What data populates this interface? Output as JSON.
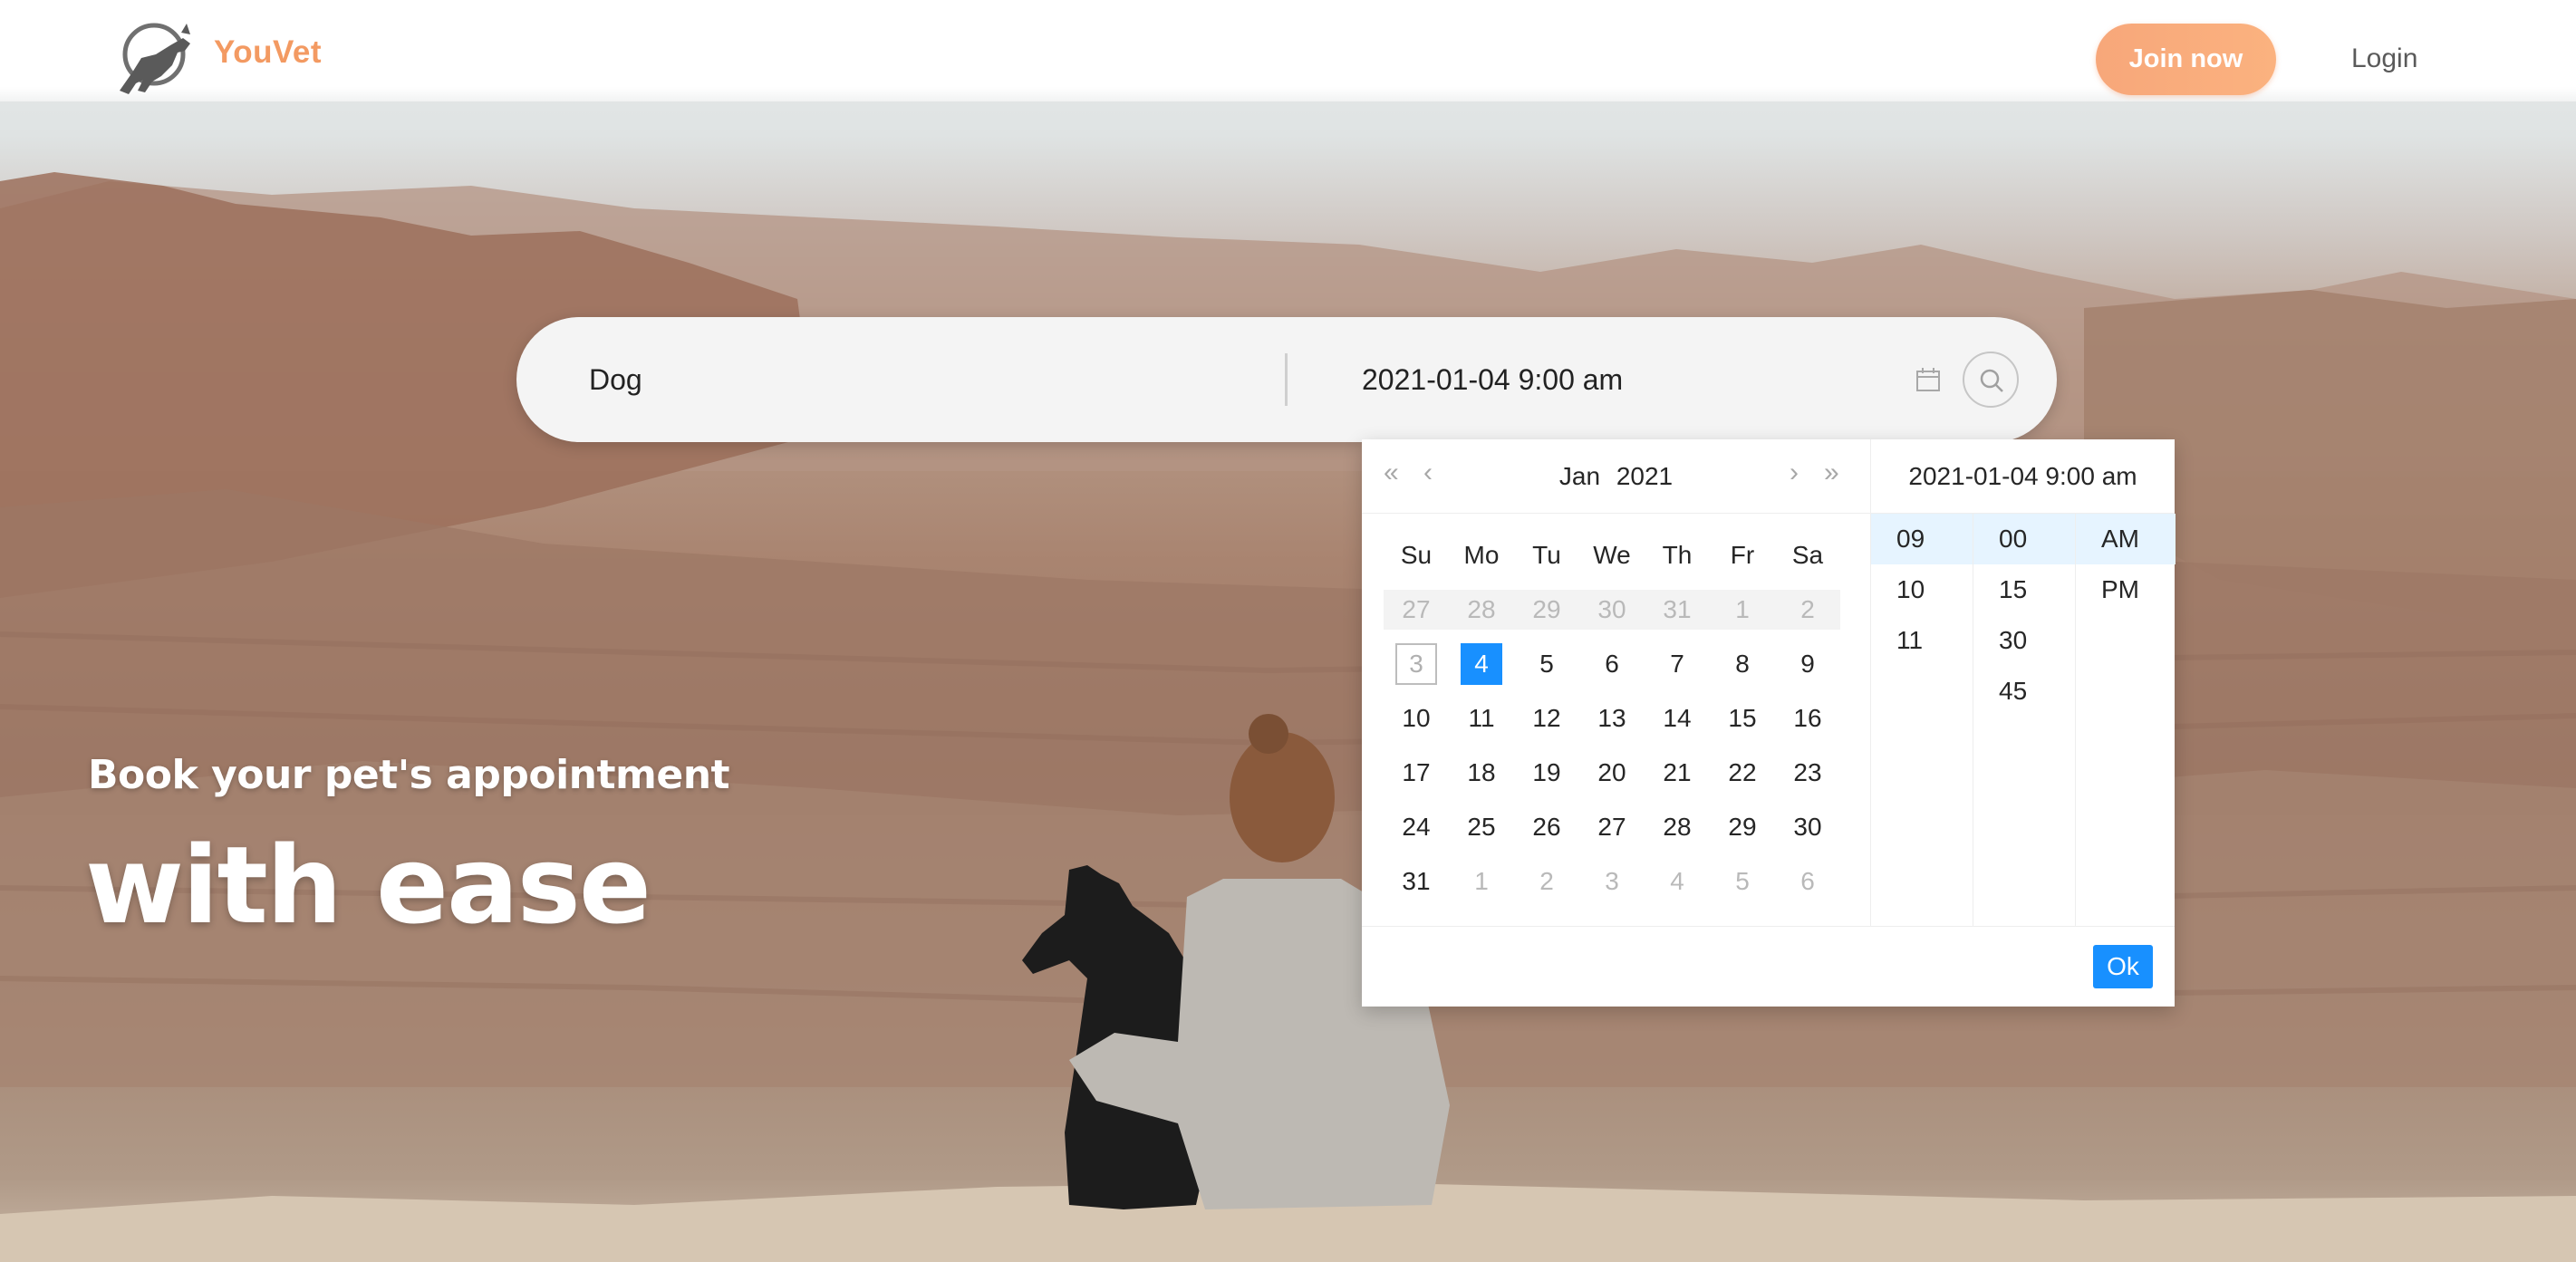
{
  "header": {
    "brand": "YouVet",
    "join_label": "Join now",
    "login_label": "Login"
  },
  "hero": {
    "subtitle": "Book your pet's appointment",
    "title": "with ease"
  },
  "search": {
    "pet_value": "Dog",
    "datetime_value": "2021-01-04 9:00 am"
  },
  "picker": {
    "month": "Jan",
    "year": "2021",
    "selected_datetime": "2021-01-04 9:00 am",
    "weekdays": [
      "Su",
      "Mo",
      "Tu",
      "We",
      "Th",
      "Fr",
      "Sa"
    ],
    "weeks": [
      [
        "27",
        "28",
        "29",
        "30",
        "31",
        "1",
        "2"
      ],
      [
        "3",
        "4",
        "5",
        "6",
        "7",
        "8",
        "9"
      ],
      [
        "10",
        "11",
        "12",
        "13",
        "14",
        "15",
        "16"
      ],
      [
        "17",
        "18",
        "19",
        "20",
        "21",
        "22",
        "23"
      ],
      [
        "24",
        "25",
        "26",
        "27",
        "28",
        "29",
        "30"
      ],
      [
        "31",
        "1",
        "2",
        "3",
        "4",
        "5",
        "6"
      ]
    ],
    "hours": [
      "09",
      "10",
      "11"
    ],
    "minutes": [
      "00",
      "15",
      "30",
      "45"
    ],
    "periods": [
      "AM",
      "PM"
    ],
    "ok_label": "Ok"
  },
  "colors": {
    "brand": "#f39a62",
    "primary": "#1890ff",
    "selected_time_bg": "#e6f4ff"
  },
  "icons": {
    "logo": "dog-logo-icon",
    "calendar": "calendar-icon",
    "search": "search-icon",
    "nav_prev_year": "double-chevron-left-icon",
    "nav_prev_month": "chevron-left-icon",
    "nav_next_month": "chevron-right-icon",
    "nav_next_year": "double-chevron-right-icon"
  }
}
